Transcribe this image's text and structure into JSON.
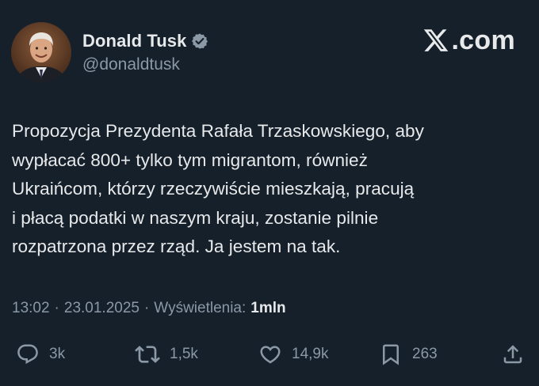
{
  "author": {
    "name": "Donald Tusk",
    "handle": "@donaldtusk",
    "verified_icon": "verified-badge-icon",
    "verified_color": "#1d9bf0"
  },
  "site": {
    "label": ".com",
    "logo_icon": "x-logo-icon"
  },
  "tweet": {
    "text": "Propozycja Prezydenta Rafała Trzaskowskiego, aby\nwypłacać 800+ tylko tym migrantom, również\nUkraińcom, którzy rzeczywiście mieszkają, pracują\ni płacą podatki w naszym kraju, zostanie pilnie\nrozpatrzona przez rząd. Ja jestem na tak."
  },
  "meta": {
    "time": "13:02",
    "separator": "·",
    "date": "23.01.2025",
    "views_label": "Wyświetlenia:",
    "views_count": "1mln"
  },
  "actions": {
    "replies": {
      "icon": "reply-icon",
      "count": "3k"
    },
    "reposts": {
      "icon": "repost-icon",
      "count": "1,5k"
    },
    "likes": {
      "icon": "heart-icon",
      "count": "14,9k"
    },
    "bookmarks": {
      "icon": "bookmark-icon",
      "count": "263"
    },
    "share": {
      "icon": "share-icon"
    }
  },
  "colors": {
    "background": "#15202b",
    "text": "#e7e9ea",
    "muted": "#8b98a5"
  }
}
